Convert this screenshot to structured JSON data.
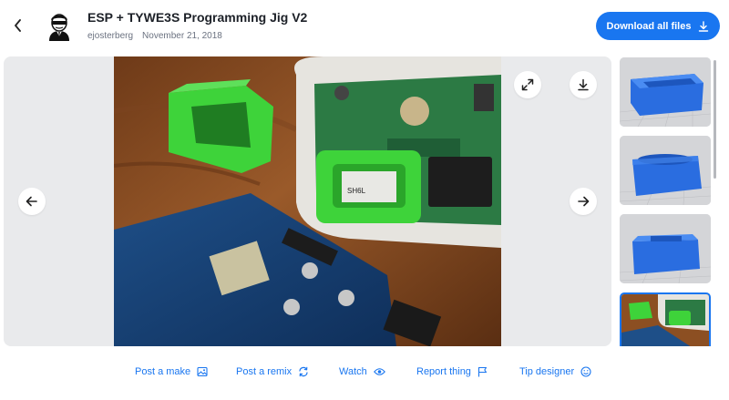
{
  "header": {
    "title": "ESP + TYWE3S Programming Jig V2",
    "author": "ejosterberg",
    "date": "November 21, 2018",
    "download_all_label": "Download all files"
  },
  "viewer": {
    "photo_module_text": "SH6L",
    "thumbnail_count": 4,
    "active_thumbnail": 4
  },
  "actions": {
    "post_make": "Post a make",
    "post_remix": "Post a remix",
    "watch": "Watch",
    "report_thing": "Report thing",
    "tip_designer": "Tip designer"
  },
  "colors": {
    "accent": "#1976f0",
    "model_blue": "#2a6de0",
    "jig_green": "#3ed33a",
    "table_wood": "#8c4f22"
  },
  "icons": [
    "back-arrow-icon",
    "designer-avatar-icon",
    "download-icon",
    "expand-icon",
    "prev-arrow-icon",
    "next-arrow-icon",
    "image-icon",
    "remix-icon",
    "eye-icon",
    "flag-icon",
    "smiley-icon"
  ]
}
